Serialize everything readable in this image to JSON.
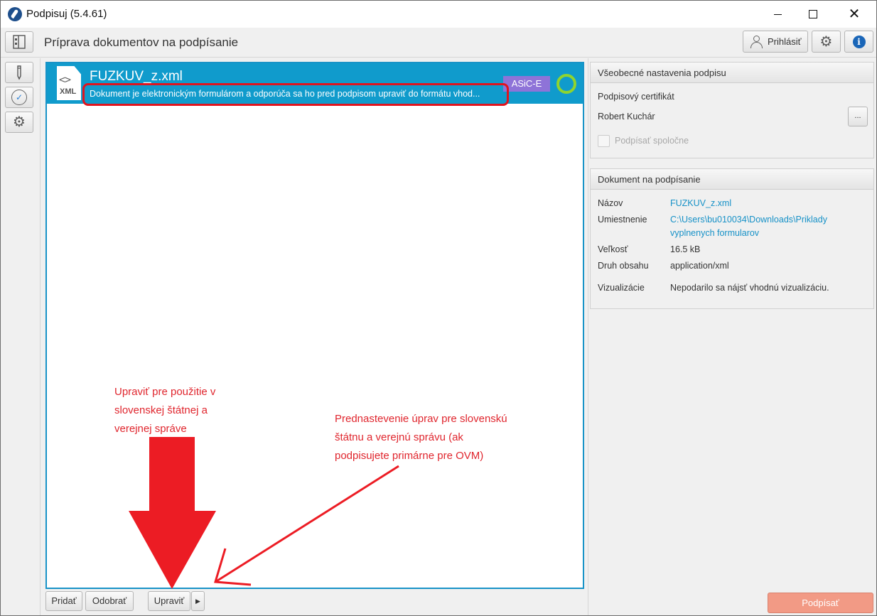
{
  "window": {
    "title": "Podpisuj (5.4.61)"
  },
  "header": {
    "page_title": "Príprava dokumentov na podpísanie",
    "login_label": "Prihlásiť",
    "info_glyph": "i"
  },
  "document": {
    "name": "FUZKUV_z.xml",
    "icon_code": "<>",
    "icon_ext": "XML",
    "hint": "Dokument je elektronickým formulárom a odporúča sa ho pred podpisom upraviť do formátu vhod...",
    "badge": "ASiC-E",
    "badge_color": "#8e73d8",
    "status_color": "#8fd42e"
  },
  "general_settings": {
    "title": "Všeobecné nastavenia podpisu",
    "cert_label": "Podpisový certifikát",
    "cert_value": "Robert Kuchár",
    "browse_label": "...",
    "co_sign_label": "Podpísať spoločne"
  },
  "doc_info": {
    "title": "Dokument na podpísanie",
    "name_label": "Názov",
    "name_value": "FUZKUV_z.xml",
    "location_label": "Umiestnenie",
    "location_line1": "C:\\Users\\bu010034\\Downloads\\Priklady",
    "location_line2": "vyplnenych formularov",
    "size_label": "Veľkosť",
    "size_value": "16.5 kB",
    "type_label": "Druh obsahu",
    "type_value": "application/xml",
    "viz_label": "Vizualizácie",
    "viz_value": "Nepodarilo sa nájsť vhodnú vizualizáciu."
  },
  "toolbar": {
    "add": "Pridať",
    "remove": "Odobrať",
    "edit": "Upraviť",
    "split_arrow": "▶",
    "sign": "Podpísať"
  },
  "annotations": {
    "left_line1": "Upraviť pre použitie v",
    "left_line2": "slovenskej štátnej a",
    "left_line3": "verejnej správe",
    "right_line1": "Prednastevenie úprav pre slovenskú",
    "right_line2": "štátnu a verejnú správu (ak",
    "right_line3": "podpisujete primárne pre OVM)",
    "color": "#e0262e"
  },
  "icons": {
    "app": "quill-icon",
    "layout": "layout-toggle-icon",
    "sign_tool": "pen-icon",
    "check_tool": "check-circle-icon",
    "cog_tool": "settings-icon",
    "gear": "gear-icon",
    "info": "info-icon",
    "user": "user-icon"
  }
}
